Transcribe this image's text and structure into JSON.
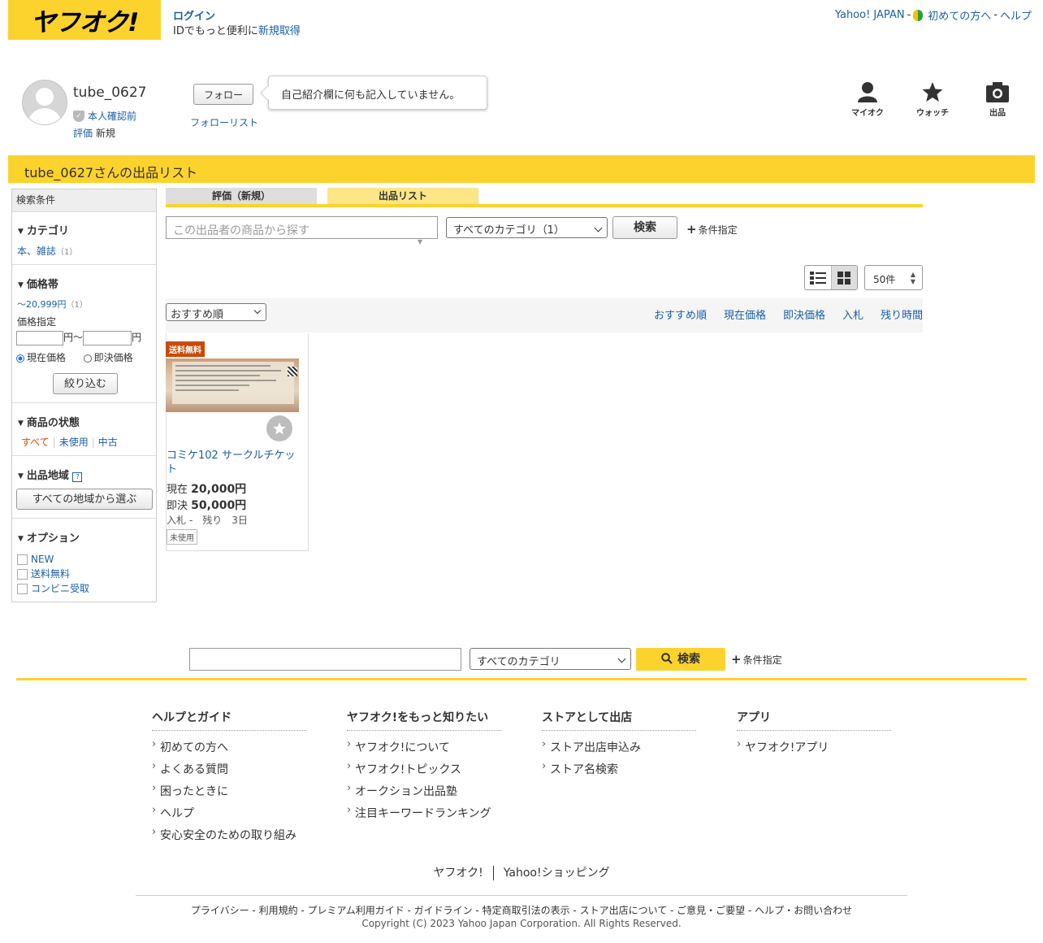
{
  "header": {
    "logo": "ヤフオク!",
    "login": "ログイン",
    "login_sub_prefix": "IDでもっと便利に",
    "signup": "新規取得",
    "links": [
      "Yahoo! JAPAN",
      "初めての方へ",
      "ヘルプ"
    ],
    "sep": "-"
  },
  "profile": {
    "username": "tube_0627",
    "verification": "本人確認前",
    "rating_label": "評価",
    "rating_value": "新規",
    "follow_button": "フォロー",
    "follow_list": "フォローリスト",
    "bio": "自己紹介欄に何も記入していません。"
  },
  "nav_icons": [
    {
      "label": "マイオク",
      "icon": "person-icon"
    },
    {
      "label": "ウォッチ",
      "icon": "star-icon"
    },
    {
      "label": "出品",
      "icon": "camera-icon"
    }
  ],
  "page_title": "tube_0627さんの出品リスト",
  "sidebar": {
    "header": "検索条件",
    "category_title": "カテゴリ",
    "category_item": "本、雑誌",
    "category_count": "（1）",
    "price_title": "価格帯",
    "price_range": "〜20,999円",
    "price_count": "（1）",
    "price_specify": "価格指定",
    "yen_from": "円〜",
    "yen_to": "円",
    "radio_current": "現在価格",
    "radio_buynow": "即決価格",
    "narrow_button": "絞り込む",
    "condition_title": "商品の状態",
    "conditions": [
      "すべて",
      "未使用",
      "中古"
    ],
    "region_title": "出品地域",
    "region_button": "すべての地域から選ぶ",
    "option_title": "オプション",
    "options": [
      "NEW",
      "送料無料",
      "コンビニ受取"
    ]
  },
  "tabs": [
    "評価（新規）",
    "出品リスト"
  ],
  "search": {
    "placeholder": "この出品者の商品から探す",
    "category": "すべてのカテゴリ（1）",
    "button": "検索",
    "condition": "条件指定"
  },
  "per_page": "50件",
  "sort": {
    "selected": "おすすめ順",
    "links": [
      "おすすめ順",
      "現在価格",
      "即決価格",
      "入札",
      "残り時間"
    ]
  },
  "item": {
    "badge": "送料無料",
    "title": "コミケ102 サークルチケット",
    "now_label": "現在",
    "now_price": "20,000円",
    "buy_label": "即決",
    "buy_price": "50,000円",
    "bid_label": "入札",
    "bid_value": "-",
    "remain_label": "残り",
    "remain_value": "3日",
    "condition": "未使用"
  },
  "footer_search": {
    "category": "すべてのカテゴリ",
    "button": "検索",
    "condition": "条件指定"
  },
  "footer_columns": [
    {
      "title": "ヘルプとガイド",
      "items": [
        "初めての方へ",
        "よくある質問",
        "困ったときに",
        "ヘルプ",
        "安心安全のための取り組み"
      ]
    },
    {
      "title": "ヤフオク!をもっと知りたい",
      "items": [
        "ヤフオク!について",
        "ヤフオク!トピックス",
        "オークション出品塾",
        "注目キーワードランキング"
      ]
    },
    {
      "title": "ストアとして出店",
      "items": [
        "ストア出店申込み",
        "ストア名検索"
      ]
    },
    {
      "title": "アプリ",
      "items": [
        "ヤフオク!アプリ"
      ]
    }
  ],
  "footer_sites": [
    "ヤフオク!",
    "Yahoo!ショッピング"
  ],
  "legal": "プライバシー - 利用規約 - プレミアム利用ガイド - ガイドライン - 特定商取引法の表示 - ストア出店について - ご意見・ご要望 - ヘルプ・お問い合わせ",
  "copyright": "Copyright (C) 2023 Yahoo Japan Corporation. All Rights Reserved.",
  "colors": {
    "brand_yellow": "#fcd22d",
    "link": "#1b5fa8",
    "badge": "#c94c06"
  }
}
